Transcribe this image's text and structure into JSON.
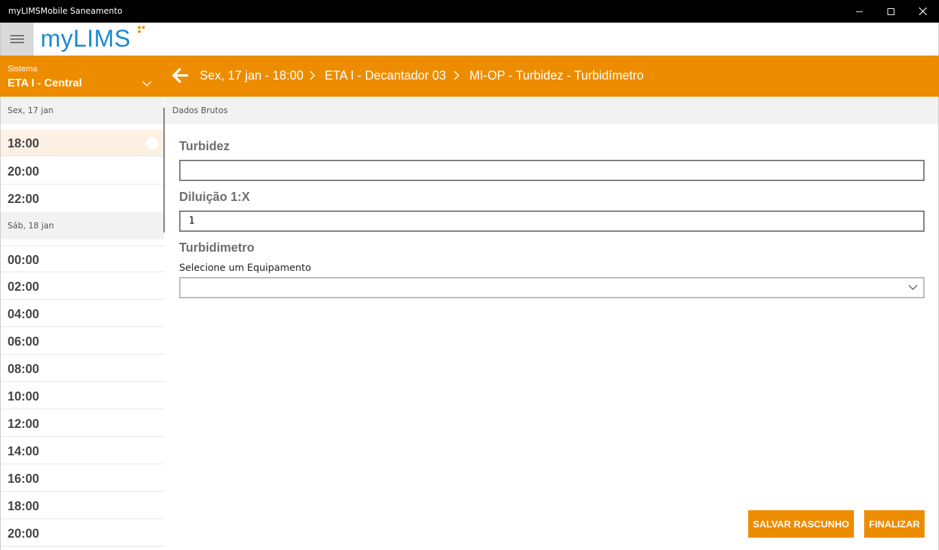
{
  "window": {
    "title": "myLIMSMobile Saneamento",
    "controls": [
      "minimize-icon",
      "maximize-icon",
      "close-icon"
    ]
  },
  "header": {
    "logo_text": "myLIMS",
    "menu_icon": "hamburger-icon"
  },
  "system": {
    "label": "Sistema",
    "value": "ETA I - Central"
  },
  "breadcrumb": {
    "items": [
      "Sex, 17 jan - 18:00",
      "ETA I - Decantador 03",
      "MI-OP - Turbidez - Turbidímetro"
    ]
  },
  "sidebar": {
    "days": [
      {
        "label": "Sex, 17 jan",
        "slots": [
          {
            "time": "18:00",
            "selected": true
          },
          {
            "time": "20:00"
          },
          {
            "time": "22:00"
          }
        ]
      },
      {
        "label": "Sáb, 18 jan",
        "slots": [
          {
            "time": "00:00"
          },
          {
            "time": "02:00"
          },
          {
            "time": "04:00"
          },
          {
            "time": "06:00"
          },
          {
            "time": "08:00"
          },
          {
            "time": "10:00"
          },
          {
            "time": "12:00"
          },
          {
            "time": "14:00"
          },
          {
            "time": "16:00"
          },
          {
            "time": "18:00"
          },
          {
            "time": "20:00"
          }
        ]
      }
    ]
  },
  "form": {
    "section_title": "Dados Brutos",
    "turbidez": {
      "label": "Turbidez",
      "value": ""
    },
    "diluicao": {
      "label": "Diluição 1:X",
      "value": "1"
    },
    "turbidimetro": {
      "label": "Turbidimetro",
      "sublabel": "Selecione um Equipamento",
      "selected": ""
    }
  },
  "actions": {
    "save_draft": "SALVAR RASCUNHO",
    "finish": "FINALIZAR"
  },
  "colors": {
    "accent": "#ee8c00",
    "logo": "#1a8ad0",
    "selected_slot": "#fdf1e3"
  }
}
